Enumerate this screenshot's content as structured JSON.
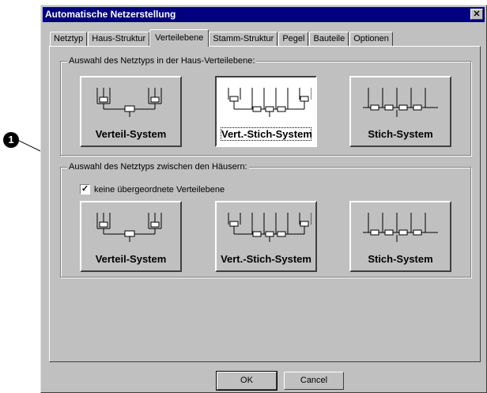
{
  "callout": {
    "number": "1"
  },
  "window": {
    "title": "Automatische Netzerstellung",
    "close_glyph": "✕"
  },
  "tabs": [
    {
      "label": "Netztyp"
    },
    {
      "label": "Haus-Struktur"
    },
    {
      "label": "Verteilebene",
      "active": true
    },
    {
      "label": "Stamm-Struktur"
    },
    {
      "label": "Pegel"
    },
    {
      "label": "Bauteile"
    },
    {
      "label": "Optionen"
    }
  ],
  "group1": {
    "label": "Auswahl des Netztyps in der Haus-Verteilebene:",
    "buttons": [
      {
        "label": "Verteil-System",
        "icon": "verteil-system-icon"
      },
      {
        "label": "Vert.-Stich-System",
        "icon": "vert-stich-system-icon",
        "selected": true
      },
      {
        "label": "Stich-System",
        "icon": "stich-system-icon"
      }
    ]
  },
  "group2": {
    "label": "Auswahl des Netztyps zwischen den Häusern:",
    "checkbox": {
      "label": "keine übergeordnete Verteilebene",
      "checked": true,
      "glyph": "✓"
    },
    "buttons": [
      {
        "label": "Verteil-System",
        "icon": "verteil-system-icon"
      },
      {
        "label": "Vert.-Stich-System",
        "icon": "vert-stich-system-icon"
      },
      {
        "label": "Stich-System",
        "icon": "stich-system-icon"
      }
    ]
  },
  "footer": {
    "ok": "OK",
    "cancel": "Cancel"
  }
}
